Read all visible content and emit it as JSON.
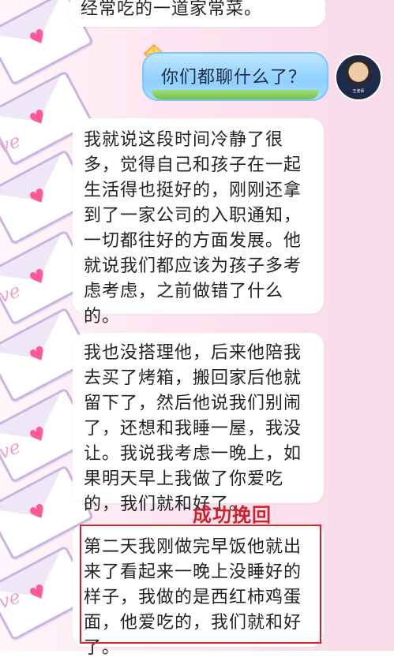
{
  "chat": {
    "top_bubble": {
      "text": "经常吃的一道家常菜。"
    },
    "my_message": {
      "text": "你们都聊什么了？",
      "avatar_label": "王老师"
    },
    "msg1": {
      "lines": [
        "我就说这段时间冷静了很",
        "多，觉得自己和孩子在一起",
        "生活得也挺好的，刚刚还拿",
        "到了一家公司的入职通知，",
        "一切都往好的方面发展。他",
        "就说我们都应该为孩子多考",
        "虑考虑，之前做错了什么",
        "的。"
      ]
    },
    "msg2": {
      "lines": [
        "我也没搭理他，后来他陪我",
        "去买了烤箱，搬回家后他就",
        "留下了，然后他说我们别闹",
        "了，还想和我睡一屋，我没",
        "让。我说我考虑一晚上，如",
        "果明天早上我做了你爱吃",
        "的，我们就和好了。"
      ]
    },
    "headline": "成功挽回",
    "msg3": {
      "lines": [
        "第二天我刚做完早饭他就出",
        "来了看起来一晚上没睡好的",
        "样子，我做的是西红柿鸡蛋",
        "面，他爱吃的，我们就和好",
        "了。"
      ]
    }
  },
  "wallpaper": {
    "love_word": "ve",
    "colors": {
      "pink": "#ff5a96",
      "envelope_border": "#c8b4e0",
      "bubble_blue": "#8fd0ff"
    }
  }
}
